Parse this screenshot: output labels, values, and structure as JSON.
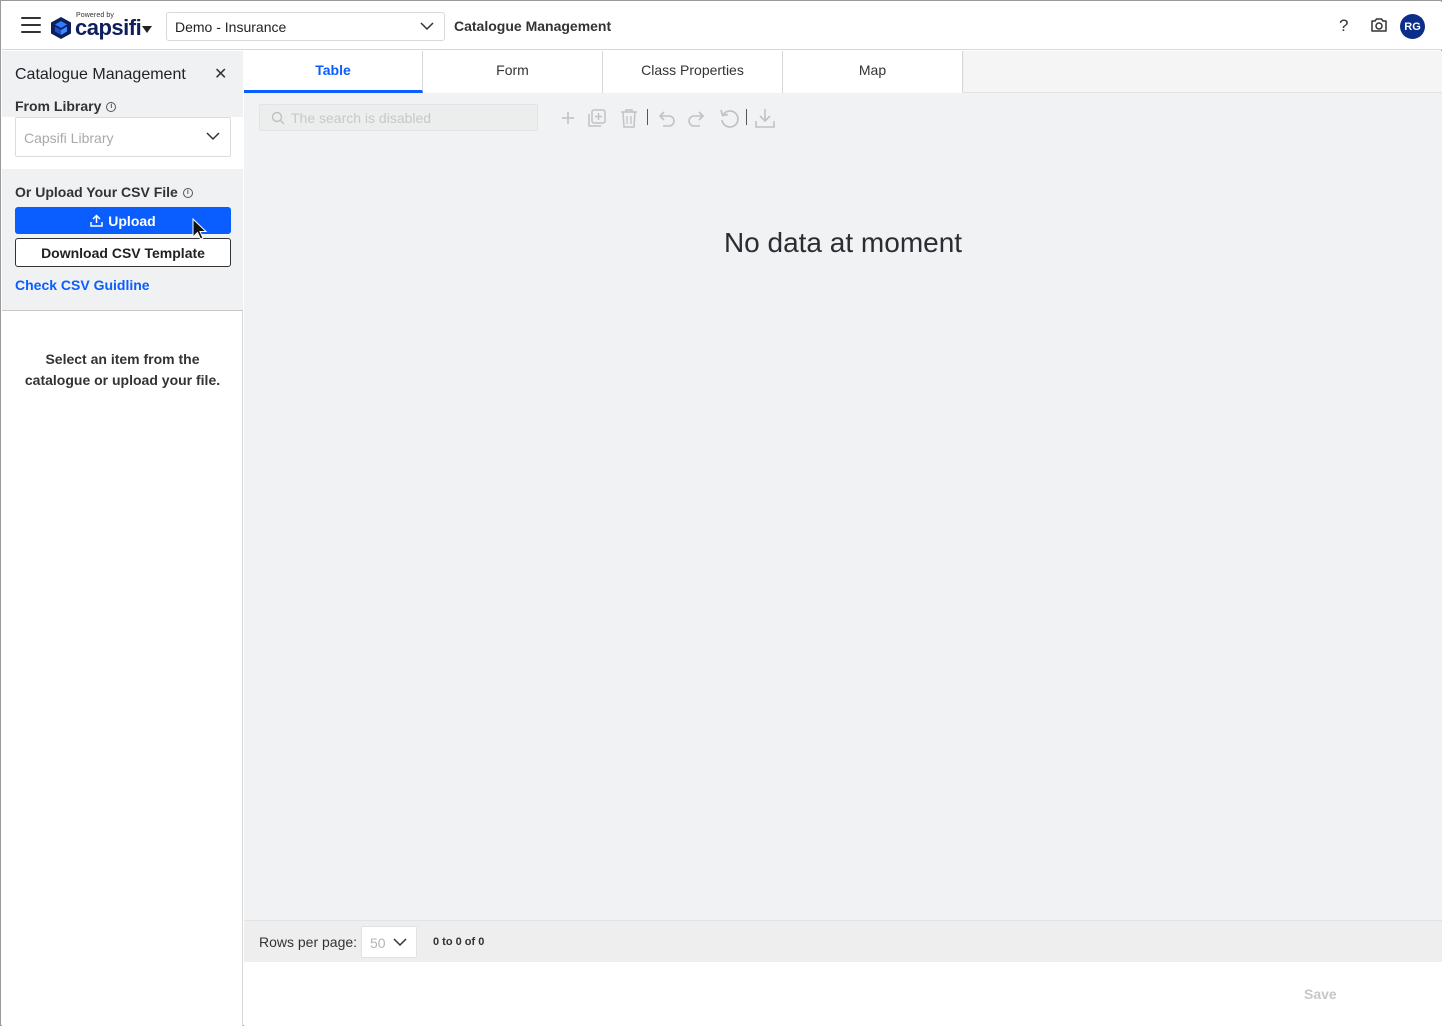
{
  "header": {
    "logo_powered": "Powered by",
    "logo_word": "capsifi",
    "workspace": "Demo - Insurance",
    "title": "Catalogue Management",
    "help": "?",
    "avatar_initials": "RG",
    "brand_color": "#0a5dff",
    "avatar_color": "#0b2e8a"
  },
  "sidebar": {
    "title": "Catalogue Management",
    "close": "✕",
    "from_library_label": "From Library",
    "library_placeholder": "Capsifi Library",
    "upload_label": "Or Upload Your CSV File",
    "upload_button": "Upload",
    "download_button": "Download CSV Template",
    "guideline_link": "Check CSV Guidline",
    "empty_line1": "Select an item from the",
    "empty_line2": "catalogue or upload your file."
  },
  "tabs": [
    "Table",
    "Form",
    "Class Properties",
    "Map"
  ],
  "active_tab": "Table",
  "toolbar": {
    "search_placeholder": "The search is disabled",
    "icons": [
      "add-icon",
      "duplicate-icon",
      "delete-icon",
      "undo-icon",
      "redo-icon",
      "reset-icon",
      "download-icon"
    ]
  },
  "main": {
    "empty_message": "No data at moment"
  },
  "pager": {
    "rows_label": "Rows per page:",
    "rows_value": "50",
    "page_info": "0 to 0 of 0"
  },
  "footer": {
    "save": "Save"
  }
}
